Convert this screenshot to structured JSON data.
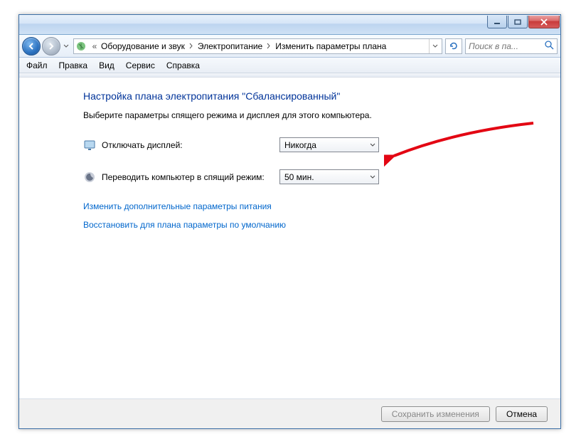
{
  "breadcrumb": {
    "items": [
      "Оборудование и звук",
      "Электропитание",
      "Изменить параметры плана"
    ]
  },
  "search": {
    "placeholder": "Поиск в па..."
  },
  "menu": {
    "items": [
      "Файл",
      "Правка",
      "Вид",
      "Сервис",
      "Справка"
    ]
  },
  "page": {
    "heading": "Настройка плана электропитания \"Сбалансированный\"",
    "subtext": "Выберите параметры спящего режима и дисплея для этого компьютера."
  },
  "settings": {
    "display_off": {
      "label": "Отключать дисплей:",
      "value": "Никогда"
    },
    "sleep": {
      "label": "Переводить компьютер в спящий режим:",
      "value": "50 мин."
    }
  },
  "links": {
    "advanced": "Изменить дополнительные параметры питания",
    "restore": "Восстановить для плана параметры по умолчанию"
  },
  "buttons": {
    "save": "Сохранить изменения",
    "cancel": "Отмена"
  }
}
